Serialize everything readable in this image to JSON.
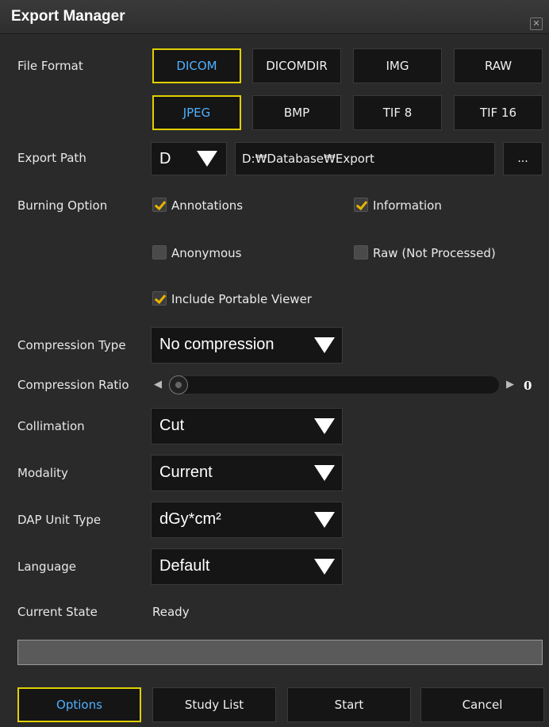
{
  "window": {
    "title": "Export Manager",
    "close_glyph": "✕"
  },
  "labels": {
    "file_format": "File Format",
    "export_path": "Export Path",
    "burning_option": "Burning Option",
    "compression_type": "Compression Type",
    "compression_ratio": "Compression Ratio",
    "collimation": "Collimation",
    "modality": "Modality",
    "dap_unit_type": "DAP Unit Type",
    "language": "Language",
    "current_state": "Current State"
  },
  "formats": {
    "row1": [
      "DICOM",
      "DICOMDIR",
      "IMG",
      "RAW"
    ],
    "row2": [
      "JPEG",
      "BMP",
      "TIF 8",
      "TIF 16"
    ],
    "selected_row1": "DICOM",
    "selected_row2": "JPEG"
  },
  "export_path": {
    "drive": "D",
    "path": "D:₩Database₩Export",
    "browse_label": "..."
  },
  "burning": {
    "annotations": {
      "label": "Annotations",
      "checked": true
    },
    "information": {
      "label": "Information",
      "checked": true
    },
    "anonymous": {
      "label": "Anonymous",
      "checked": false
    },
    "raw": {
      "label": "Raw (Not Processed)",
      "checked": false
    },
    "portable_viewer": {
      "label": "Include Portable Viewer",
      "checked": true
    }
  },
  "compression_type": "No compression",
  "compression_ratio": {
    "value": "0",
    "fraction": 0.0
  },
  "collimation": "Cut",
  "modality": "Current",
  "dap_unit_type": "dGy*cm²",
  "language": "Default",
  "current_state": "Ready",
  "progress": 0,
  "buttons": {
    "options": "Options",
    "study_list": "Study List",
    "start": "Start",
    "cancel": "Cancel"
  },
  "colors": {
    "selected_border": "#e0d000",
    "selected_text": "#4fb0ff",
    "check_mark": "#e8b400"
  }
}
